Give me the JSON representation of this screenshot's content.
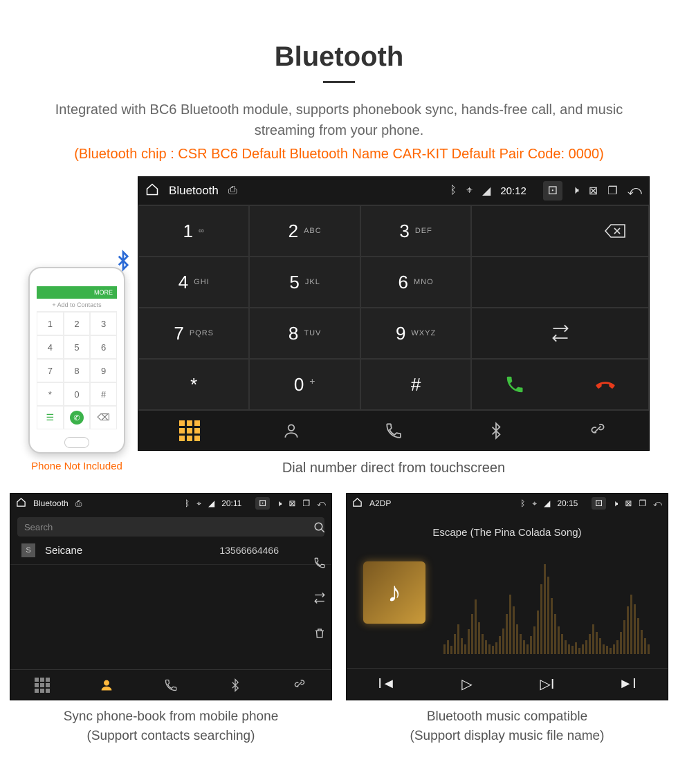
{
  "title": "Bluetooth",
  "subtitle": "Integrated with BC6 Bluetooth module, supports phonebook sync, hands-free call, and music streaming from your phone.",
  "spec": "(Bluetooth chip : CSR BC6     Default Bluetooth Name CAR-KIT     Default Pair Code: 0000)",
  "phone": {
    "bar": "MORE",
    "add": "Add to Contacts",
    "caption": "Phone Not Included"
  },
  "main": {
    "title": "Bluetooth",
    "time": "20:12",
    "keys": [
      {
        "d": "1",
        "l": "∞"
      },
      {
        "d": "2",
        "l": "ABC"
      },
      {
        "d": "3",
        "l": "DEF"
      },
      {
        "d": "4",
        "l": "GHI"
      },
      {
        "d": "5",
        "l": "JKL"
      },
      {
        "d": "6",
        "l": "MNO"
      },
      {
        "d": "7",
        "l": "PQRS"
      },
      {
        "d": "8",
        "l": "TUV"
      },
      {
        "d": "9",
        "l": "WXYZ"
      },
      {
        "d": "*",
        "l": ""
      },
      {
        "d": "0",
        "l": "+",
        "sup": true
      },
      {
        "d": "#",
        "l": ""
      }
    ],
    "caption": "Dial number direct from touchscreen"
  },
  "contacts": {
    "title": "Bluetooth",
    "time": "20:11",
    "search": "Search",
    "badge": "S",
    "name": "Seicane",
    "number": "13566664466",
    "caption1": "Sync phone-book from mobile phone",
    "caption2": "(Support contacts searching)"
  },
  "music": {
    "title": "A2DP",
    "time": "20:15",
    "track": "Escape (The Pina Colada Song)",
    "caption1": "Bluetooth music compatible",
    "caption2": "(Support display music file name)"
  }
}
